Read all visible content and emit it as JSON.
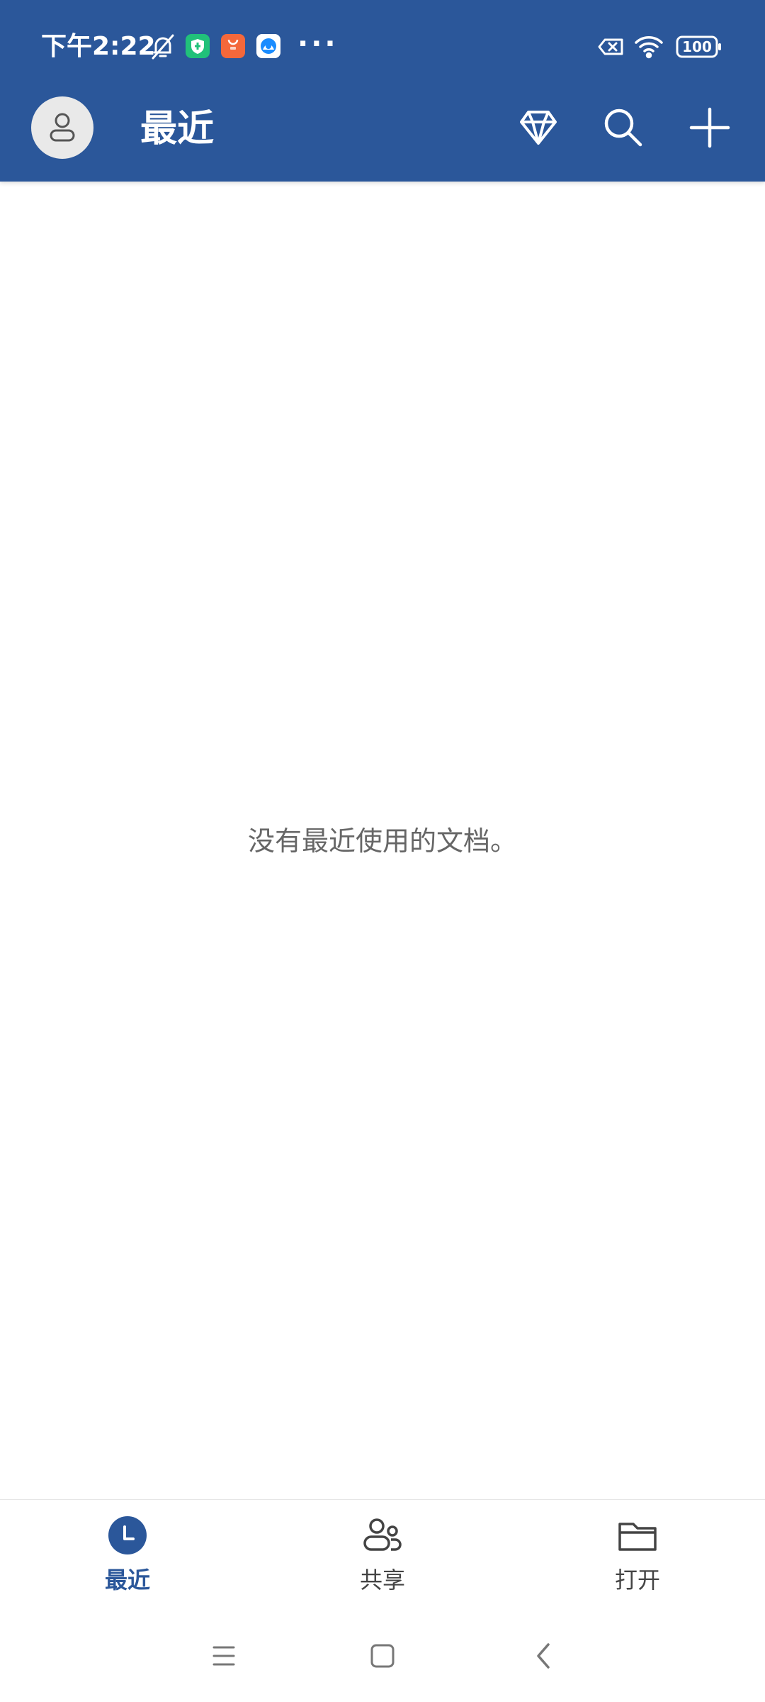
{
  "status_bar": {
    "time": "下午2:22",
    "more_indicator": "···",
    "battery_level": "100",
    "icons": [
      "bell-muted-icon",
      "security-app-icon",
      "shop-app-icon",
      "browser-app-icon",
      "sim-no-signal-icon",
      "wifi-icon",
      "battery-icon"
    ]
  },
  "header": {
    "title": "最近",
    "actions": [
      "avatar",
      "premium-diamond-icon",
      "search-icon",
      "add-icon"
    ]
  },
  "main": {
    "empty_message": "没有最近使用的文档。"
  },
  "bottom_nav": {
    "items": [
      {
        "label": "最近",
        "icon": "clock-icon",
        "active": true
      },
      {
        "label": "共享",
        "icon": "shared-people-icon",
        "active": false
      },
      {
        "label": "打开",
        "icon": "folder-icon",
        "active": false
      }
    ]
  },
  "system_nav": [
    "menu-icon",
    "home-icon",
    "back-icon"
  ],
  "colors": {
    "brand": "#2b579a",
    "background": "#ffffff",
    "empty_text": "#666666"
  }
}
